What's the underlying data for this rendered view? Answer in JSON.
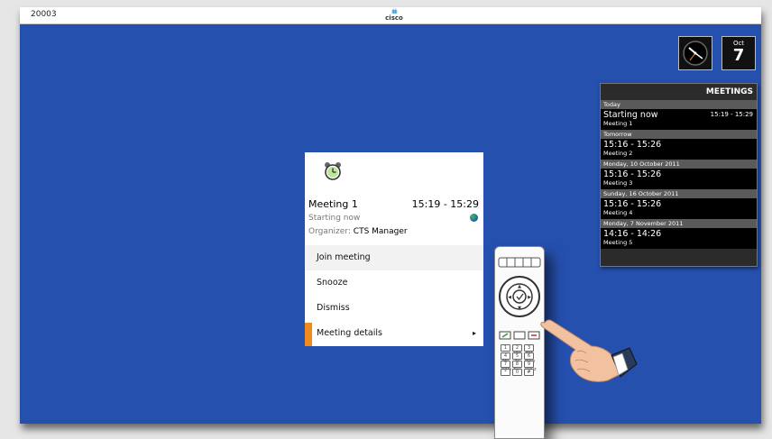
{
  "topbar": {
    "system_id": "20003",
    "logo_text": "cisco"
  },
  "widgets": {
    "calendar_month": "Oct",
    "calendar_day": "7"
  },
  "meetings_panel": {
    "title": "MEETINGS",
    "sections": [
      {
        "header": "Today",
        "items": [
          {
            "time": "Starting now",
            "name": "Meeting 1",
            "range": "15:19 - 15:29"
          }
        ]
      },
      {
        "header": "Tomorrow",
        "items": [
          {
            "time": "15:16 - 15:26",
            "name": "Meeting 2"
          }
        ]
      },
      {
        "header": "Monday, 10 October 2011",
        "items": [
          {
            "time": "15:16 - 15:26",
            "name": "Meeting 3"
          }
        ]
      },
      {
        "header": "Sunday, 16 October 2011",
        "items": [
          {
            "time": "15:16 - 15:26",
            "name": "Meeting 4"
          }
        ]
      },
      {
        "header": "Monday, 7 November 2011",
        "items": [
          {
            "time": "14:16 - 14:26",
            "name": "Meeting 5"
          }
        ]
      }
    ]
  },
  "dialog": {
    "title": "Meeting 1",
    "time_range": "15:19 - 15:29",
    "status": "Starting now",
    "organizer_label": "Organizer:",
    "organizer_name": "CTS Manager",
    "menu": [
      {
        "label": "Join meeting"
      },
      {
        "label": "Snooze"
      },
      {
        "label": "Dismiss"
      },
      {
        "label": "Meeting details",
        "chevron": "▸"
      }
    ],
    "selected_index": 3,
    "accent_color": "#f08a1c"
  },
  "remote_keys": [
    "1",
    "2 abc",
    "3 def",
    "4 ghi",
    "5 jkl",
    "6 mno",
    "7 pqrs",
    "8 tuv",
    "9 wxyz",
    "*",
    "0",
    "#"
  ],
  "colors": {
    "background": "#2550ae"
  }
}
